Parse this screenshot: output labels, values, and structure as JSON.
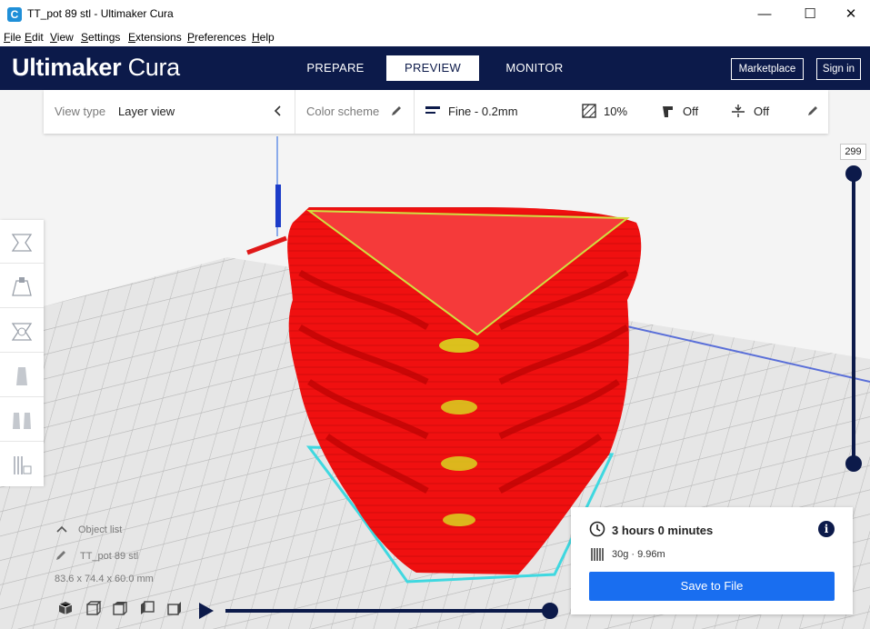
{
  "window": {
    "title": "TT_pot 89 stl - Ultimaker Cura",
    "app_icon": "C",
    "controls": {
      "minimize": "—",
      "maximize": "☐",
      "close": "✕"
    }
  },
  "menu": [
    "File",
    "Edit",
    "View",
    "Settings",
    "Extensions",
    "Preferences",
    "Help"
  ],
  "header": {
    "logo_bold": "Ultimaker",
    "logo_light": "Cura",
    "stages": [
      {
        "label": "PREPARE",
        "active": false
      },
      {
        "label": "PREVIEW",
        "active": true
      },
      {
        "label": "MONITOR",
        "active": false
      }
    ],
    "marketplace_label": "Marketplace",
    "signin_label": "Sign in"
  },
  "toolbar": {
    "view_type_label": "View type",
    "view_type_value": "Layer view",
    "color_scheme_label": "Color scheme",
    "profile": "Fine - 0.2mm",
    "infill": "10%",
    "support": "Off",
    "adhesion": "Off"
  },
  "layer_slider": {
    "current_layer": "299",
    "level": 1.0
  },
  "object_list": {
    "header": "Object list",
    "item_name": "TT_pot 89 stl",
    "dimensions": "83.6 x 74.4 x 60.0 mm"
  },
  "simulation": {
    "progress": 1.0
  },
  "print_info": {
    "time": "3 hours 0 minutes",
    "material": "30g · 9.96m",
    "save_label": "Save to File"
  },
  "colors": {
    "accent_navy": "#0c1a4a",
    "save_blue": "#196ef0",
    "model_red": "#f01010",
    "skirt_cyan": "#3fd8e0"
  }
}
